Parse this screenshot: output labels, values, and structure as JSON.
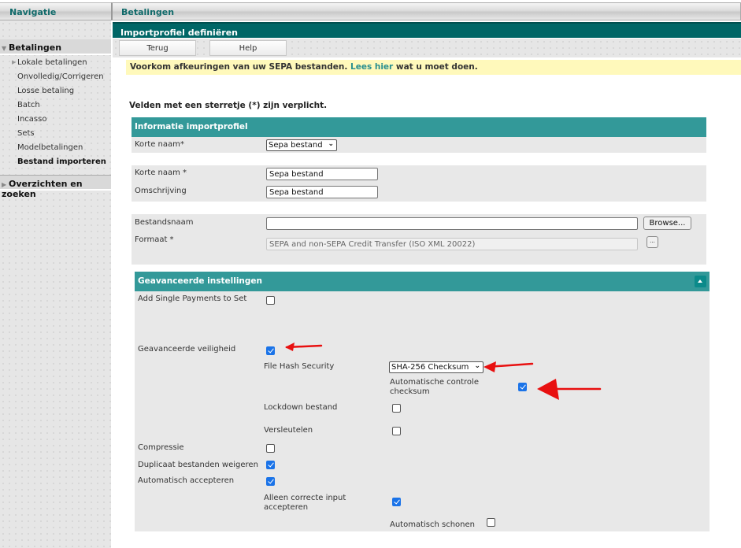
{
  "sidebar": {
    "header": "Navigatie",
    "groups": [
      {
        "label": "Betalingen",
        "expanded": true,
        "items": [
          {
            "label": "Lokale betalingen",
            "has_children": true
          },
          {
            "label": "Onvolledig/Corrigeren"
          },
          {
            "label": "Losse betaling"
          },
          {
            "label": "Batch"
          },
          {
            "label": "Incasso"
          },
          {
            "label": "Sets"
          },
          {
            "label": "Modelbetalingen"
          },
          {
            "label": "Bestand importeren",
            "active": true
          }
        ]
      },
      {
        "label": "Overzichten en zoeken",
        "expanded": false
      }
    ]
  },
  "header": {
    "section_title": "Betalingen",
    "page_title": "Importprofiel definiëren"
  },
  "toolbar": {
    "back_label": "Terug",
    "help_label": "Help"
  },
  "notice": {
    "text_before": "Voorkom afkeuringen van uw SEPA bestanden.",
    "link": "Lees hier",
    "text_after": "wat u moet doen."
  },
  "required_note": "Velden met een sterretje (*) zijn verplicht.",
  "info_panel": {
    "title": "Informatie importprofiel",
    "profile_select_label": "Korte naam*",
    "profile_select_value": "Sepa bestand"
  },
  "name_panel": {
    "short_name_label": "Korte naam *",
    "short_name_value": "Sepa bestand",
    "description_label": "Omschrijving",
    "description_value": "Sepa bestand"
  },
  "file_panel": {
    "filename_label": "Bestandsnaam",
    "filename_value": "",
    "browse_label": "Browse...",
    "format_label": "Formaat *",
    "format_value": "SEPA and non-SEPA Credit Transfer (ISO XML 20022)",
    "format_picker_label": "..."
  },
  "advanced_panel": {
    "title": "Geavanceerde instellingen",
    "add_single_payments": {
      "label": "Add Single Payments to Set",
      "checked": false
    },
    "advanced_security": {
      "label": "Geavanceerde veiligheid",
      "checked": true
    },
    "file_hash_security": {
      "label": "File Hash Security",
      "value": "SHA-256 Checksum"
    },
    "auto_checksum": {
      "label_line1": "Automatische controle",
      "label_line2": "checksum",
      "checked": true
    },
    "lockdown_file": {
      "label": "Lockdown bestand",
      "checked": false
    },
    "encrypt": {
      "label": "Versleutelen",
      "checked": false
    },
    "compression": {
      "label": "Compressie",
      "checked": false
    },
    "reject_duplicates": {
      "label": "Duplicaat bestanden weigeren",
      "checked": true
    },
    "auto_accept": {
      "label": "Automatisch accepteren",
      "checked": true
    },
    "accept_correct_only": {
      "label_line1": "Alleen correcte input",
      "label_line2": "accepteren",
      "checked": true
    },
    "auto_clean": {
      "label": "Automatisch schonen",
      "checked": false
    }
  },
  "colors": {
    "teal_dark": "#006666",
    "teal_panel": "#339999",
    "notice_bg": "#fff9bb",
    "annotation_red": "#e81010"
  }
}
